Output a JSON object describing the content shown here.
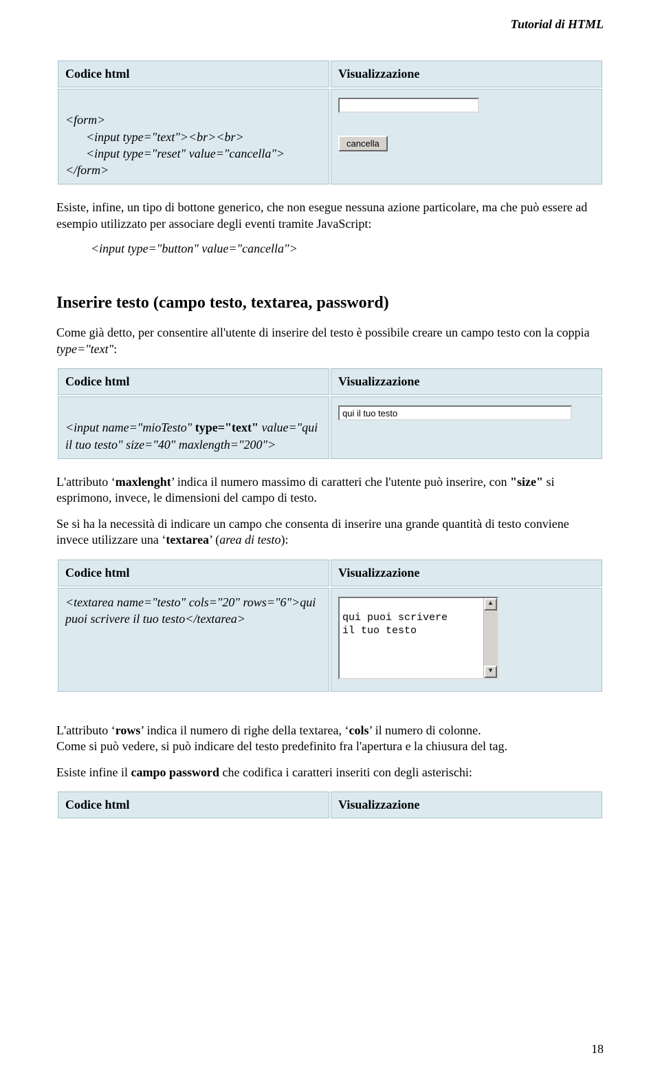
{
  "header": {
    "title": "Tutorial di HTML"
  },
  "table_headers": {
    "code": "Codice html",
    "vis": "Visualizzazione"
  },
  "ex1": {
    "line1": "<form>",
    "line2": "<input type=\"text\"><br><br>",
    "line3": "<input type=\"reset\" value=\"cancella\">",
    "line4": "</form>",
    "button_label": "cancella"
  },
  "p1": "Esiste, infine, un tipo di bottone generico, che non esegue nessuna azione particolare, ma che può essere ad esempio utilizzato per associare degli eventi tramite JavaScript:",
  "inline_code1": "<input type=\"button\" value=\"cancella\">",
  "section_title": "Inserire testo (campo testo, textarea, password)",
  "p2_a": "Come già detto, per consentire all'utente di inserire del testo è possibile creare un campo testo con la coppia ",
  "p2_b": "type=\"text\"",
  "p2_c": ":",
  "ex2": {
    "code_a": "<input name=\"mioTesto\" ",
    "code_b": "type=\"text\"",
    "code_c": " value=\"qui il tuo testo\" size=\"40\" maxlength=\"200\">",
    "input_value": "qui il tuo testo"
  },
  "p3_a": "L'attributo ‘",
  "p3_b": "maxlenght",
  "p3_c": "’ indica il numero massimo di caratteri che l'utente può inserire, con ",
  "p3_d": "\"size\"",
  "p3_e": " si esprimono, invece, le dimensioni del campo di testo.",
  "p4_a": "Se si ha la necessità di indicare un campo che consenta di inserire una grande quantità di testo conviene invece utilizzare una ‘",
  "p4_b": "textarea",
  "p4_c": "’ (",
  "p4_d": "area di testo",
  "p4_e": "):",
  "ex3": {
    "code": "<textarea name=\"testo\" cols=\"20\" rows=\"6\">qui puoi scrivere il tuo testo</textarea>",
    "ta_value": "qui puoi scrivere\nil tuo testo"
  },
  "p5_a": "L'attributo ‘",
  "p5_b": "rows",
  "p5_c": "’ indica il numero di righe della textarea, ‘",
  "p5_d": "cols",
  "p5_e": "’ il numero di colonne.\nCome si può vedere, si può indicare del testo predefinito fra l'apertura e la chiusura del tag.",
  "p6_a": "Esiste infine il ",
  "p6_b": "campo password",
  "p6_c": " che codifica i caratteri inseriti con degli asterischi:",
  "page_number": "18"
}
